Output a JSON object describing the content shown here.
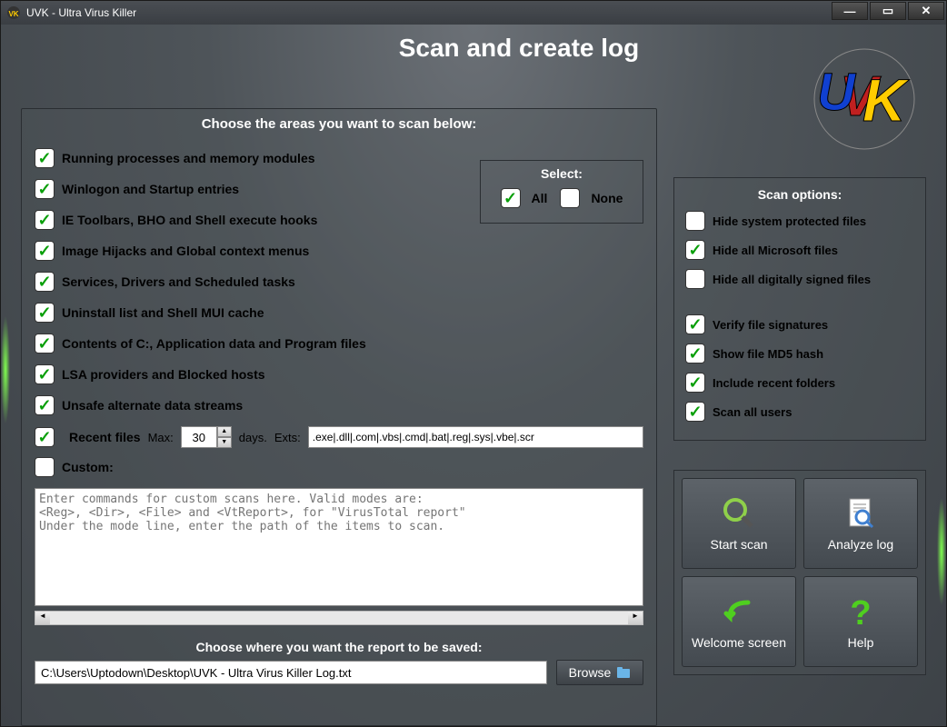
{
  "window": {
    "title": "UVK - Ultra Virus Killer"
  },
  "page": {
    "title": "Scan and create log",
    "subtitle": "Choose the areas you want to scan below:"
  },
  "scanAreas": [
    {
      "label": "Running processes and memory modules",
      "checked": true
    },
    {
      "label": "Winlogon and Startup entries",
      "checked": true
    },
    {
      "label": "IE Toolbars, BHO and Shell execute hooks",
      "checked": true
    },
    {
      "label": "Image Hijacks and Global context menus",
      "checked": true
    },
    {
      "label": "Services, Drivers and Scheduled tasks",
      "checked": true
    },
    {
      "label": "Uninstall list and Shell MUI cache",
      "checked": true
    },
    {
      "label": "Contents of C:, Application data and Program files",
      "checked": true
    },
    {
      "label": "LSA providers and Blocked hosts",
      "checked": true
    },
    {
      "label": "Unsafe alternate data streams",
      "checked": true
    }
  ],
  "recent": {
    "checked": true,
    "label": "Recent files",
    "maxLabel": "Max:",
    "maxValue": "30",
    "daysLabel": "days.",
    "extsLabel": "Exts:",
    "extsValue": ".exe|.dll|.com|.vbs|.cmd|.bat|.reg|.sys|.vbe|.scr"
  },
  "custom": {
    "checked": false,
    "label": "Custom:",
    "placeholder": "Enter commands for custom scans here. Valid modes are:\n<Reg>, <Dir>, <File> and <VtReport>, for \"VirusTotal report\"\nUnder the mode line, enter the path of the items to scan."
  },
  "selectBox": {
    "title": "Select:",
    "all": "All",
    "none": "None",
    "allChecked": true,
    "noneChecked": false
  },
  "report": {
    "label": "Choose where you want the report to be saved:",
    "path": "C:\\Users\\Uptodown\\Desktop\\UVK - Ultra Virus Killer Log.txt",
    "browse": "Browse"
  },
  "scanOptions": {
    "title": "Scan options:",
    "items1": [
      {
        "label": "Hide system protected files",
        "checked": false
      },
      {
        "label": "Hide all Microsoft files",
        "checked": true
      },
      {
        "label": "Hide all digitally signed files",
        "checked": false
      }
    ],
    "items2": [
      {
        "label": "Verify file signatures",
        "checked": true
      },
      {
        "label": "Show file MD5 hash",
        "checked": true
      },
      {
        "label": "Include recent folders",
        "checked": true
      },
      {
        "label": "Scan all users",
        "checked": true
      }
    ]
  },
  "buttons": {
    "startScan": "Start scan",
    "analyzeLog": "Analyze log",
    "welcome": "Welcome screen",
    "help": "Help"
  }
}
